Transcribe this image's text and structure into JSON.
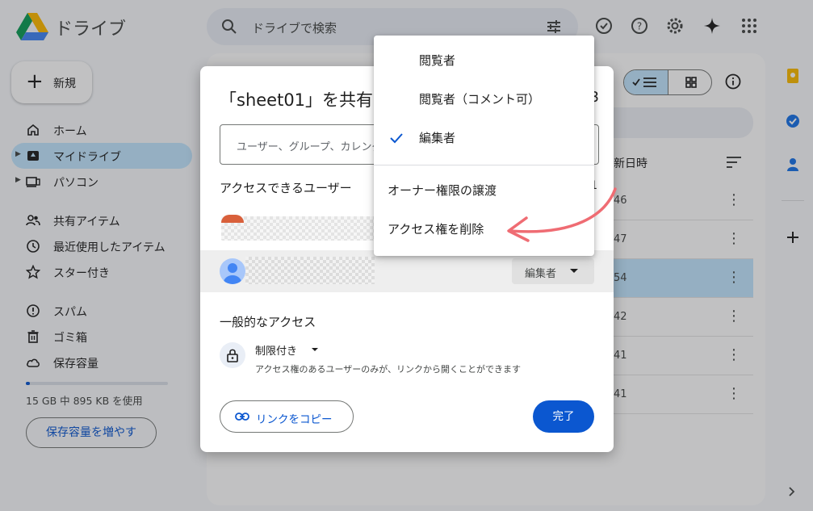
{
  "app": {
    "brand": "ドライブ",
    "search_placeholder": "ドライブで検索"
  },
  "sidebar": {
    "new_label": "新規",
    "items": [
      {
        "label": "ホーム",
        "icon": "home-icon"
      },
      {
        "label": "マイドライブ",
        "icon": "my-drive-icon"
      },
      {
        "label": "パソコン",
        "icon": "computer-icon"
      },
      {
        "label": "共有アイテム",
        "icon": "shared-icon"
      },
      {
        "label": "最近使用したアイテム",
        "icon": "clock-icon"
      },
      {
        "label": "スター付き",
        "icon": "star-icon"
      },
      {
        "label": "スパム",
        "icon": "spam-icon"
      },
      {
        "label": "ゴミ箱",
        "icon": "trash-icon"
      },
      {
        "label": "保存容量",
        "icon": "cloud-icon"
      }
    ],
    "storage_text": "15 GB 中 895 KB を使用",
    "more_storage_label": "保存容量を増やす"
  },
  "main": {
    "col_header": "新日時",
    "rows": [
      "46",
      "47",
      "54",
      "42",
      "41",
      "41"
    ]
  },
  "dialog": {
    "title": "「sheet01」を共有",
    "title_tail": "3",
    "add_placeholder": "ユーザー、グループ、カレンダーの予定を追加",
    "access_users_title": "アクセスできるユーザー",
    "access_users_tail": "1",
    "role_label": "編集者",
    "general_access_title": "一般的なアクセス",
    "restricted_label": "制限付き",
    "restricted_desc": "アクセス権のあるユーザーのみが、リンクから開くことができます",
    "copy_link_label": "リンクをコピー",
    "done_label": "完了"
  },
  "role_menu": {
    "items": [
      {
        "label": "閲覧者",
        "checked": false
      },
      {
        "label": "閲覧者（コメント可）",
        "checked": false
      },
      {
        "label": "編集者",
        "checked": true
      },
      {
        "label": "オーナー権限の譲渡",
        "checked": false
      },
      {
        "label": "アクセス権を削除",
        "checked": false
      }
    ]
  },
  "colors": {
    "accent": "#0b57d0",
    "selection": "#c2e7ff",
    "annotation_arrow": "#ef6c73"
  }
}
